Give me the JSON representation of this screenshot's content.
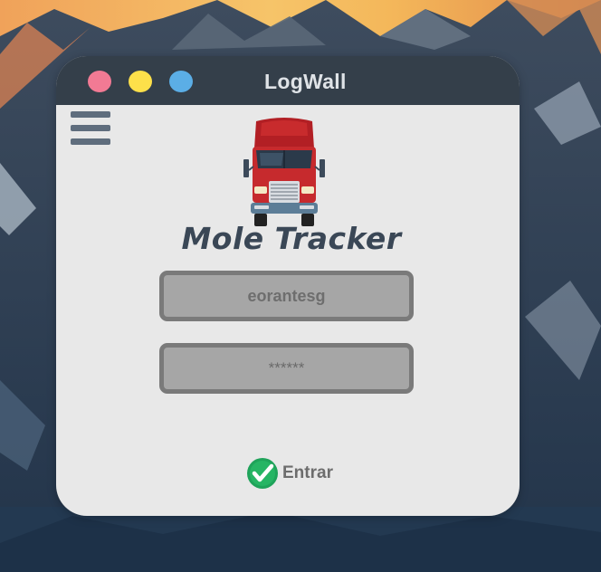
{
  "window": {
    "title": "LogWall",
    "traffic_lights": [
      "#f27a94",
      "#fde04a",
      "#5baee6"
    ]
  },
  "menu": {
    "icon": "hamburger-menu-icon"
  },
  "app": {
    "logo_icon": "red-semi-truck-icon",
    "name": "Mole Tracker"
  },
  "form": {
    "username": "eorantesg",
    "password_mask": "******",
    "submit_label": "Entrar",
    "submit_icon": "green-check-circle-icon"
  },
  "colors": {
    "window_bg": "#e8e8e8",
    "titlebar": "#343f4a",
    "field_bg": "#a6a6a6",
    "field_border": "#7a7a7a",
    "check_green": "#1fa35a"
  }
}
